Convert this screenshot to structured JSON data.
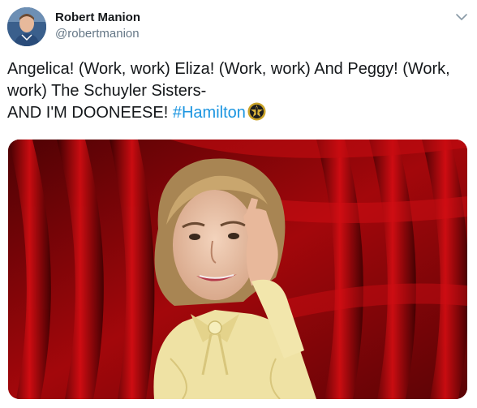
{
  "author": {
    "display_name": "Robert Manion",
    "handle": "@robertmanion"
  },
  "tweet": {
    "line1": "Angelica! (Work, work) Eliza! (Work, work) And Peggy! (Work, work) The Schuyler Sisters-",
    "line2": "AND I'M DOONEESE!",
    "hashtag": "#Hamilton",
    "hashtag_emoji": "hamilton-star-icon"
  },
  "colors": {
    "hashtag": "#1b95e0",
    "curtain_red": "#b4090d",
    "handle_gray": "#657786"
  },
  "icons": {
    "menu": "chevron-down-icon"
  }
}
